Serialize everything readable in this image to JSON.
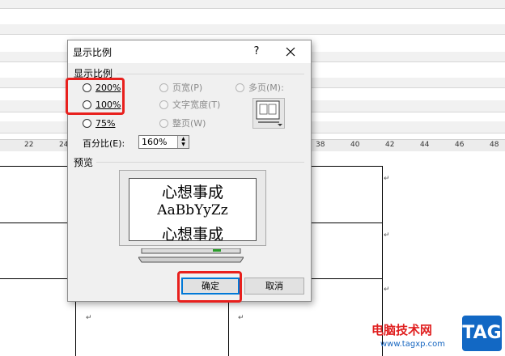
{
  "dialog": {
    "title": "显示比例",
    "help_label": "?",
    "zoom_group_label": "显示比例",
    "options_left": [
      {
        "label": "200%",
        "selected": false
      },
      {
        "label": "100%",
        "selected": false
      },
      {
        "label": "75%",
        "selected": false
      }
    ],
    "options_middle": [
      {
        "label": "页宽(P)"
      },
      {
        "label": "文字宽度(T)"
      },
      {
        "label": "整页(W)"
      }
    ],
    "multipage_label": "多页(M):",
    "percent_label": "百分比(E):",
    "percent_value": "160%",
    "preview_label": "预览",
    "preview_lines": [
      "心想事成",
      "AaBbYyZz",
      "心想事成"
    ],
    "ok_label": "确定",
    "cancel_label": "取消"
  },
  "ruler": {
    "ticks": [
      "22",
      "24",
      "38",
      "40",
      "42",
      "44",
      "46",
      "48"
    ]
  },
  "watermark": {
    "site": "电脑技术网",
    "url": "www.tagxp.com",
    "tag": "TAG"
  },
  "colors": {
    "highlight": "#e8201d",
    "default_button_border": "#0078d7"
  }
}
